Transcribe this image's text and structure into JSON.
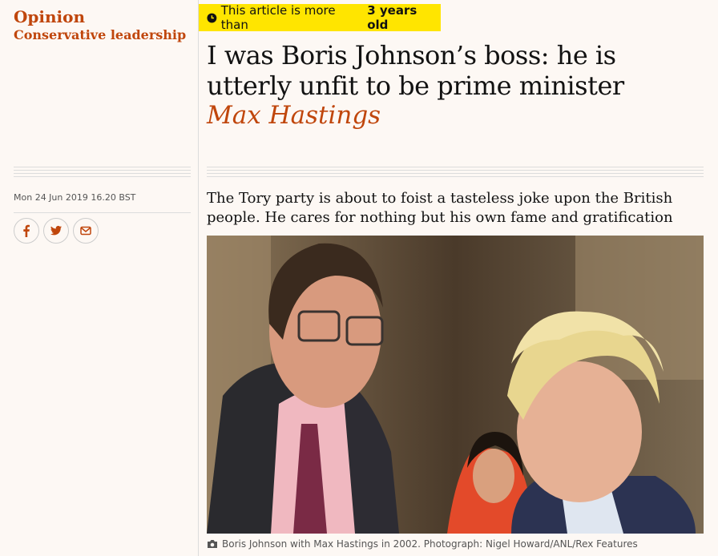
{
  "section": {
    "name": "Opinion",
    "series": "Conservative leadership"
  },
  "banner": {
    "prefix": "This article is more than",
    "age": "3 years old"
  },
  "article": {
    "headline": "I was Boris Johnson’s boss: he is utterly unfit to be prime minister",
    "byline": "Max Hastings",
    "date": "Mon 24 Jun 2019 16.20 BST",
    "standfirst": "The Tory party is about to foist a tasteless joke upon the British people. He cares for nothing but his own fame and gratification"
  },
  "share": {
    "icons": [
      "facebook-icon",
      "twitter-icon",
      "email-icon"
    ]
  },
  "image": {
    "caption": "Boris Johnson with Max Hastings in 2002. Photograph: Nigel Howard/ANL/Rex Features"
  },
  "colors": {
    "accent": "#c0460c",
    "banner": "#ffe500",
    "background": "#fdf8f4"
  }
}
